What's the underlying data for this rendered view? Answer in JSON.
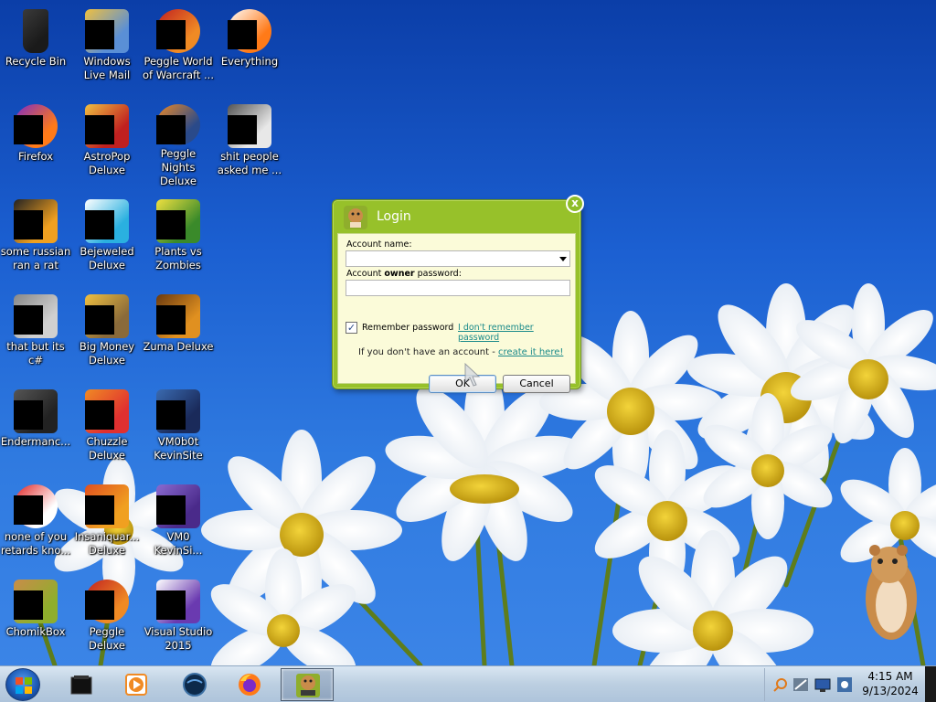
{
  "desktop_icons": [
    {
      "label": "Recycle Bin",
      "icon": "recycle-bin-icon"
    },
    {
      "label": "Windows Live Mail",
      "icon": "windows-live-mail-icon"
    },
    {
      "label": "Peggle World of Warcraft ...",
      "icon": "peggle-wow-icon"
    },
    {
      "label": "Everything",
      "icon": "everything-search-icon"
    },
    {
      "label": "Firefox",
      "icon": "firefox-icon"
    },
    {
      "label": "AstroPop Deluxe",
      "icon": "astropop-icon"
    },
    {
      "label": "Peggle Nights Deluxe",
      "icon": "peggle-nights-icon"
    },
    {
      "label": "shit people asked me ...",
      "icon": "file-shortcut-icon"
    },
    {
      "label": "some russian ran a rat",
      "icon": "russian-rat-icon"
    },
    {
      "label": "Bejeweled Deluxe",
      "icon": "bejeweled-icon"
    },
    {
      "label": "Plants vs Zombies",
      "icon": "plants-vs-zombies-icon"
    },
    {
      "label": "that but its c#",
      "icon": "folder-stack-icon"
    },
    {
      "label": "Big Money Deluxe",
      "icon": "big-money-icon"
    },
    {
      "label": "Zuma Deluxe",
      "icon": "zuma-icon"
    },
    {
      "label": "Endermanc...",
      "icon": "endermanch-icon"
    },
    {
      "label": "Chuzzle Deluxe",
      "icon": "chuzzle-icon"
    },
    {
      "label": "VM0b0t KevinSite",
      "icon": "vm0b0t-icon"
    },
    {
      "label": "none of you retards kno...",
      "icon": "red-circle-icon"
    },
    {
      "label": "Insaniquar... Deluxe",
      "icon": "insaniquarium-icon"
    },
    {
      "label": "VM0 KevinSi...",
      "icon": "vm0-kevinsite-icon"
    },
    {
      "label": "ChomikBox",
      "icon": "chomikbox-icon"
    },
    {
      "label": "Peggle Deluxe",
      "icon": "peggle-deluxe-icon"
    },
    {
      "label": "Visual Studio 2015",
      "icon": "visual-studio-icon"
    }
  ],
  "login_dialog": {
    "title": "Login",
    "close_label": "x",
    "account_name_label": "Account name:",
    "account_name_value": "",
    "password_label_prefix": "Account ",
    "password_label_bold": "owner",
    "password_label_suffix": " password:",
    "password_value": "",
    "remember_checked": true,
    "remember_mark": "✓",
    "remember_label": "Remember password",
    "forgot_link": "I don't remember password",
    "no_account_text": "If you don't have an account - ",
    "create_link": "create it here!",
    "ok_label": "OK",
    "cancel_label": "Cancel",
    "accent_color": "#97c12a"
  },
  "taskbar": {
    "start_button": "windows-start-icon",
    "pinned": [
      {
        "name": "taskbar-app-black-box",
        "icon": "black-box-icon"
      },
      {
        "name": "taskbar-app-media-player",
        "icon": "media-player-icon"
      },
      {
        "name": "taskbar-app-globe",
        "icon": "globe-icon"
      },
      {
        "name": "taskbar-app-firefox",
        "icon": "firefox-icon"
      },
      {
        "name": "taskbar-app-chomikbox",
        "icon": "chomikbox-icon",
        "active": true
      }
    ],
    "tray_icons": [
      "search-tray-icon",
      "network-tray-icon",
      "monitor-tray-icon",
      "settings-tray-icon"
    ],
    "clock_time": "4:15 AM",
    "clock_date": "9/13/2024"
  }
}
